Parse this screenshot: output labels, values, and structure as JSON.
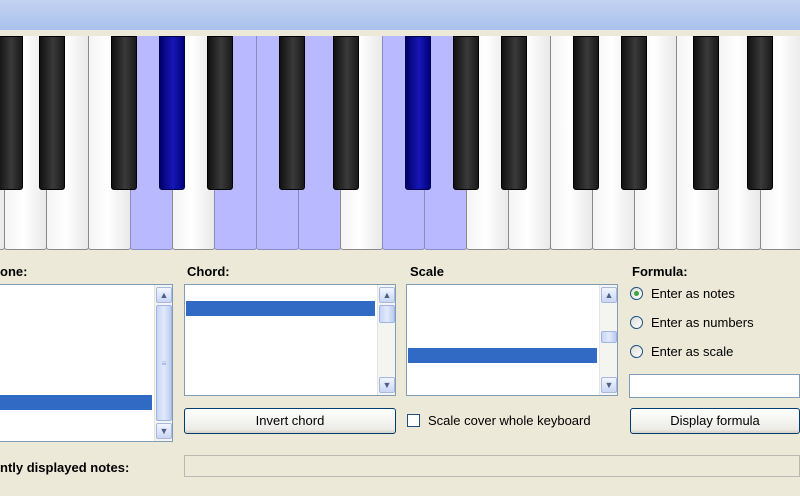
{
  "window": {
    "title": ""
  },
  "keyboard": {
    "white_keys_highlighted": [
      3,
      5,
      6,
      7,
      9,
      10
    ],
    "black_keys_highlighted": [
      3,
      7
    ]
  },
  "labels": {
    "tone": "one:",
    "chord": "Chord:",
    "scale": "Scale",
    "formula": "Formula:",
    "displayed_notes": "ntly displayed notes:"
  },
  "buttons": {
    "invert_chord": "Invert chord",
    "display_formula": "Display formula"
  },
  "checkbox": {
    "scale_cover": "Scale cover whole keyboard",
    "checked": false
  },
  "formula_options": [
    {
      "label": "Enter as notes",
      "selected": true
    },
    {
      "label": "Enter as numbers",
      "selected": false
    },
    {
      "label": "Enter as scale",
      "selected": false
    }
  ],
  "inputs": {
    "formula_value": "",
    "displayed_notes_value": ""
  },
  "icons": {
    "scroll_up": "▲",
    "scroll_down": "▼",
    "thumb_grip": "≡"
  }
}
